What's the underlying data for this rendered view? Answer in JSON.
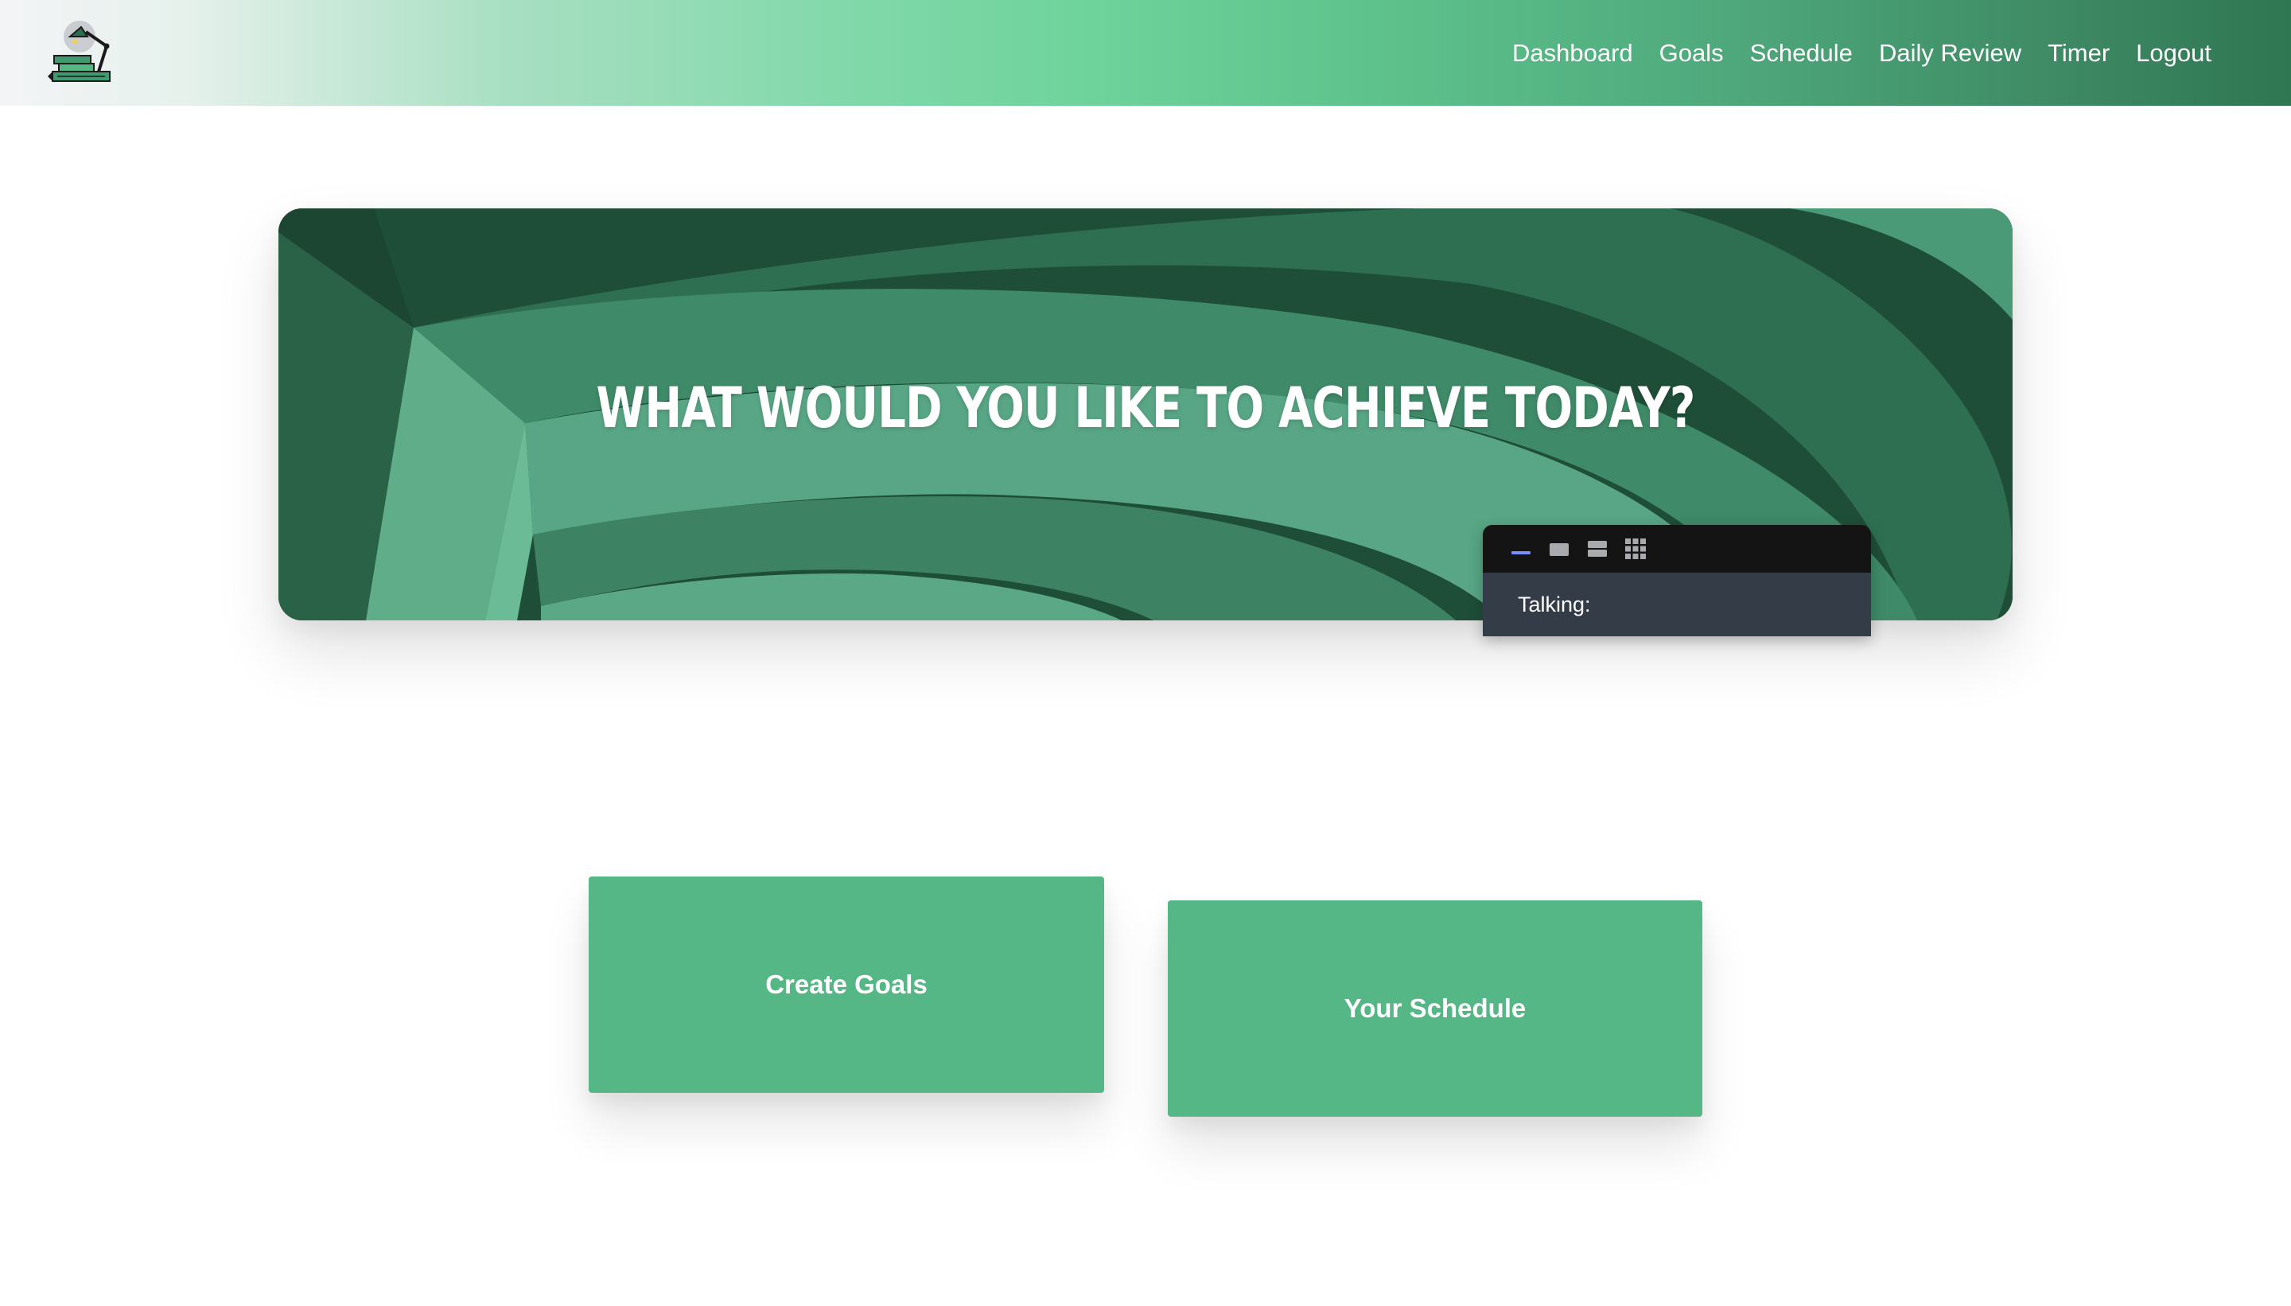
{
  "nav": {
    "logo_icon": "desk-lamp-books-icon",
    "links": [
      {
        "label": "Dashboard"
      },
      {
        "label": "Goals"
      },
      {
        "label": "Schedule"
      },
      {
        "label": "Daily Review"
      },
      {
        "label": "Timer"
      },
      {
        "label": "Logout"
      }
    ]
  },
  "hero": {
    "title": "WHAT WOULD YOU LIKE TO ACHIEVE TODAY?"
  },
  "voice_widget": {
    "buttons": [
      {
        "icon": "minimize-icon"
      },
      {
        "icon": "single-view-icon"
      },
      {
        "icon": "split-view-icon"
      },
      {
        "icon": "grid-view-icon"
      }
    ],
    "label": "Talking:"
  },
  "actions": {
    "create_goals": "Create Goals",
    "your_schedule": "Your Schedule"
  },
  "colors": {
    "brand_green": "#55b785",
    "hero_dark": "#235a40",
    "widget_toolbar": "#141414",
    "widget_body": "#343c48",
    "minimize_accent": "#7b8cff"
  }
}
